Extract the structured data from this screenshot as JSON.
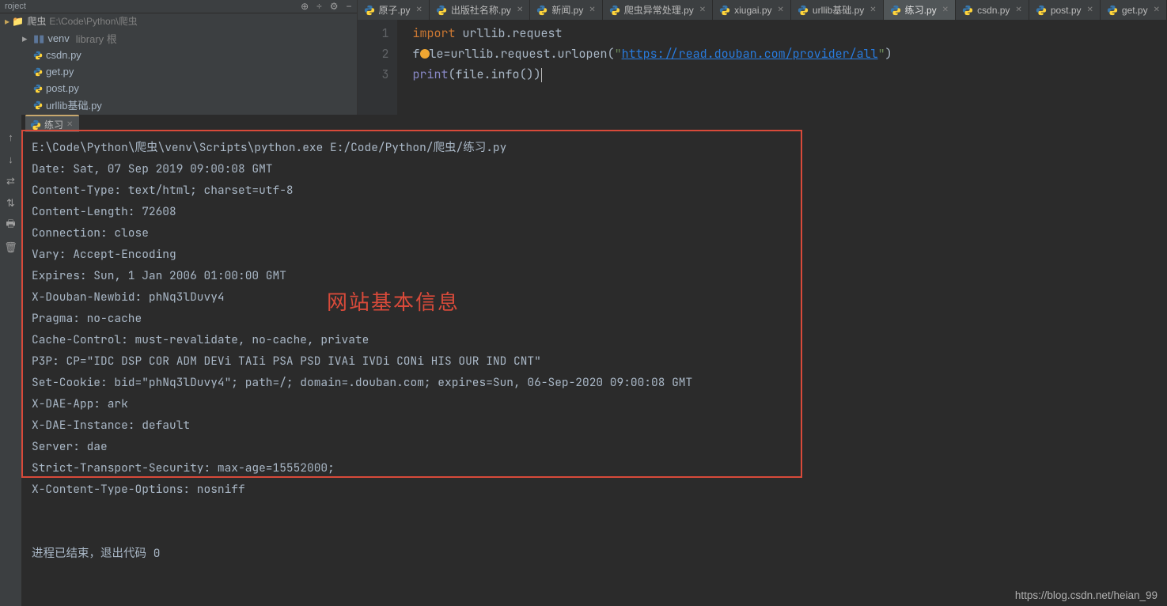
{
  "project": {
    "panel_label": "roject",
    "header_icons": [
      "⊕",
      "÷",
      "⚙",
      "−"
    ],
    "breadcrumb_icon_text": "爬虫",
    "breadcrumb_path": "E:\\Code\\Python\\爬虫",
    "tree": {
      "venv": {
        "twisty": "▸",
        "name": "venv",
        "hint": "library 根"
      },
      "files": [
        "csdn.py",
        "get.py",
        "post.py",
        "urllib基础.py"
      ]
    }
  },
  "editor": {
    "tabs": [
      "原子.py",
      "出版社名称.py",
      "新闻.py",
      "爬虫异常处理.py",
      "xiugai.py",
      "urllib基础.py",
      "练习.py",
      "csdn.py",
      "post.py",
      "get.py"
    ],
    "active_tab_index": 6,
    "gutter": [
      "1",
      "2",
      "3"
    ],
    "code": {
      "l1_import": "import",
      "l1_rest": " urllib.request",
      "l2_pre": "f",
      "l2_var": "le",
      "l2_eq": "=urllib.request.urlopen(",
      "l2_url": "https://read.douban.com/provider/all",
      "l2_close": ")",
      "l3_print": "print",
      "l3_open": "(",
      "l3_mid": "file.info()",
      "l3_close": ")"
    }
  },
  "console": {
    "tab_label": "练习",
    "toolbar": [
      "↑",
      "↓",
      "⇄",
      "⇅",
      "🖶",
      "🗑"
    ],
    "lines": [
      "E:\\Code\\Python\\爬虫\\venv\\Scripts\\python.exe E:/Code/Python/爬虫/练习.py",
      "Date: Sat, 07 Sep 2019 09:00:08 GMT",
      "Content-Type: text/html; charset=utf-8",
      "Content-Length: 72608",
      "Connection: close",
      "Vary: Accept-Encoding",
      "Expires: Sun, 1 Jan 2006 01:00:00 GMT",
      "X-Douban-Newbid: phNq3lDuvy4",
      "Pragma: no-cache",
      "Cache-Control: must-revalidate, no-cache, private",
      "P3P: CP=\"IDC DSP COR ADM DEVi TAIi PSA PSD IVAi IVDi CONi HIS OUR IND CNT\"",
      "Set-Cookie: bid=\"phNq3lDuvy4\"; path=/; domain=.douban.com; expires=Sun, 06-Sep-2020 09:00:08 GMT",
      "X-DAE-App: ark",
      "X-DAE-Instance: default",
      "Server: dae",
      "Strict-Transport-Security: max-age=15552000;",
      "X-Content-Type-Options: nosniff",
      "",
      "",
      "进程已结束，退出代码 0"
    ],
    "annotation": "网站基本信息"
  },
  "watermark": "https://blog.csdn.net/heian_99"
}
